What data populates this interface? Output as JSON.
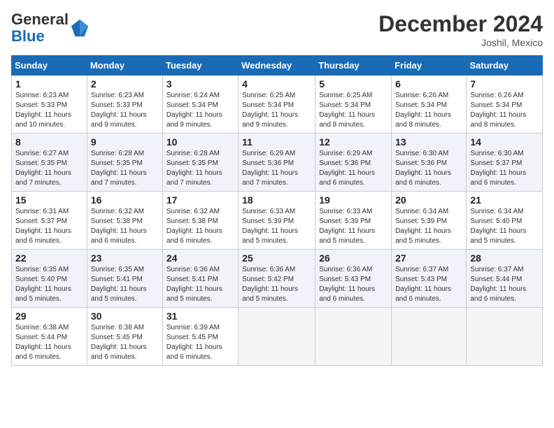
{
  "header": {
    "logo_general": "General",
    "logo_blue": "Blue",
    "month_title": "December 2024",
    "location": "Joshil, Mexico"
  },
  "days_of_week": [
    "Sunday",
    "Monday",
    "Tuesday",
    "Wednesday",
    "Thursday",
    "Friday",
    "Saturday"
  ],
  "weeks": [
    [
      {
        "day": "1",
        "sunrise": "6:23 AM",
        "sunset": "5:33 PM",
        "daylight": "11 hours and 10 minutes."
      },
      {
        "day": "2",
        "sunrise": "6:23 AM",
        "sunset": "5:33 PM",
        "daylight": "11 hours and 9 minutes."
      },
      {
        "day": "3",
        "sunrise": "6:24 AM",
        "sunset": "5:34 PM",
        "daylight": "11 hours and 9 minutes."
      },
      {
        "day": "4",
        "sunrise": "6:25 AM",
        "sunset": "5:34 PM",
        "daylight": "11 hours and 9 minutes."
      },
      {
        "day": "5",
        "sunrise": "6:25 AM",
        "sunset": "5:34 PM",
        "daylight": "11 hours and 8 minutes."
      },
      {
        "day": "6",
        "sunrise": "6:26 AM",
        "sunset": "5:34 PM",
        "daylight": "11 hours and 8 minutes."
      },
      {
        "day": "7",
        "sunrise": "6:26 AM",
        "sunset": "5:34 PM",
        "daylight": "11 hours and 8 minutes."
      }
    ],
    [
      {
        "day": "8",
        "sunrise": "6:27 AM",
        "sunset": "5:35 PM",
        "daylight": "11 hours and 7 minutes."
      },
      {
        "day": "9",
        "sunrise": "6:28 AM",
        "sunset": "5:35 PM",
        "daylight": "11 hours and 7 minutes."
      },
      {
        "day": "10",
        "sunrise": "6:28 AM",
        "sunset": "5:35 PM",
        "daylight": "11 hours and 7 minutes."
      },
      {
        "day": "11",
        "sunrise": "6:29 AM",
        "sunset": "5:36 PM",
        "daylight": "11 hours and 7 minutes."
      },
      {
        "day": "12",
        "sunrise": "6:29 AM",
        "sunset": "5:36 PM",
        "daylight": "11 hours and 6 minutes."
      },
      {
        "day": "13",
        "sunrise": "6:30 AM",
        "sunset": "5:36 PM",
        "daylight": "11 hours and 6 minutes."
      },
      {
        "day": "14",
        "sunrise": "6:30 AM",
        "sunset": "5:37 PM",
        "daylight": "11 hours and 6 minutes."
      }
    ],
    [
      {
        "day": "15",
        "sunrise": "6:31 AM",
        "sunset": "5:37 PM",
        "daylight": "11 hours and 6 minutes."
      },
      {
        "day": "16",
        "sunrise": "6:32 AM",
        "sunset": "5:38 PM",
        "daylight": "11 hours and 6 minutes."
      },
      {
        "day": "17",
        "sunrise": "6:32 AM",
        "sunset": "5:38 PM",
        "daylight": "11 hours and 6 minutes."
      },
      {
        "day": "18",
        "sunrise": "6:33 AM",
        "sunset": "5:39 PM",
        "daylight": "11 hours and 5 minutes."
      },
      {
        "day": "19",
        "sunrise": "6:33 AM",
        "sunset": "5:39 PM",
        "daylight": "11 hours and 5 minutes."
      },
      {
        "day": "20",
        "sunrise": "6:34 AM",
        "sunset": "5:39 PM",
        "daylight": "11 hours and 5 minutes."
      },
      {
        "day": "21",
        "sunrise": "6:34 AM",
        "sunset": "5:40 PM",
        "daylight": "11 hours and 5 minutes."
      }
    ],
    [
      {
        "day": "22",
        "sunrise": "6:35 AM",
        "sunset": "5:40 PM",
        "daylight": "11 hours and 5 minutes."
      },
      {
        "day": "23",
        "sunrise": "6:35 AM",
        "sunset": "5:41 PM",
        "daylight": "11 hours and 5 minutes."
      },
      {
        "day": "24",
        "sunrise": "6:36 AM",
        "sunset": "5:41 PM",
        "daylight": "11 hours and 5 minutes."
      },
      {
        "day": "25",
        "sunrise": "6:36 AM",
        "sunset": "5:42 PM",
        "daylight": "11 hours and 5 minutes."
      },
      {
        "day": "26",
        "sunrise": "6:36 AM",
        "sunset": "5:43 PM",
        "daylight": "11 hours and 6 minutes."
      },
      {
        "day": "27",
        "sunrise": "6:37 AM",
        "sunset": "5:43 PM",
        "daylight": "11 hours and 6 minutes."
      },
      {
        "day": "28",
        "sunrise": "6:37 AM",
        "sunset": "5:44 PM",
        "daylight": "11 hours and 6 minutes."
      }
    ],
    [
      {
        "day": "29",
        "sunrise": "6:38 AM",
        "sunset": "5:44 PM",
        "daylight": "11 hours and 6 minutes."
      },
      {
        "day": "30",
        "sunrise": "6:38 AM",
        "sunset": "5:45 PM",
        "daylight": "11 hours and 6 minutes."
      },
      {
        "day": "31",
        "sunrise": "6:39 AM",
        "sunset": "5:45 PM",
        "daylight": "11 hours and 6 minutes."
      },
      null,
      null,
      null,
      null
    ]
  ],
  "labels": {
    "sunrise": "Sunrise:",
    "sunset": "Sunset:",
    "daylight": "Daylight:"
  }
}
